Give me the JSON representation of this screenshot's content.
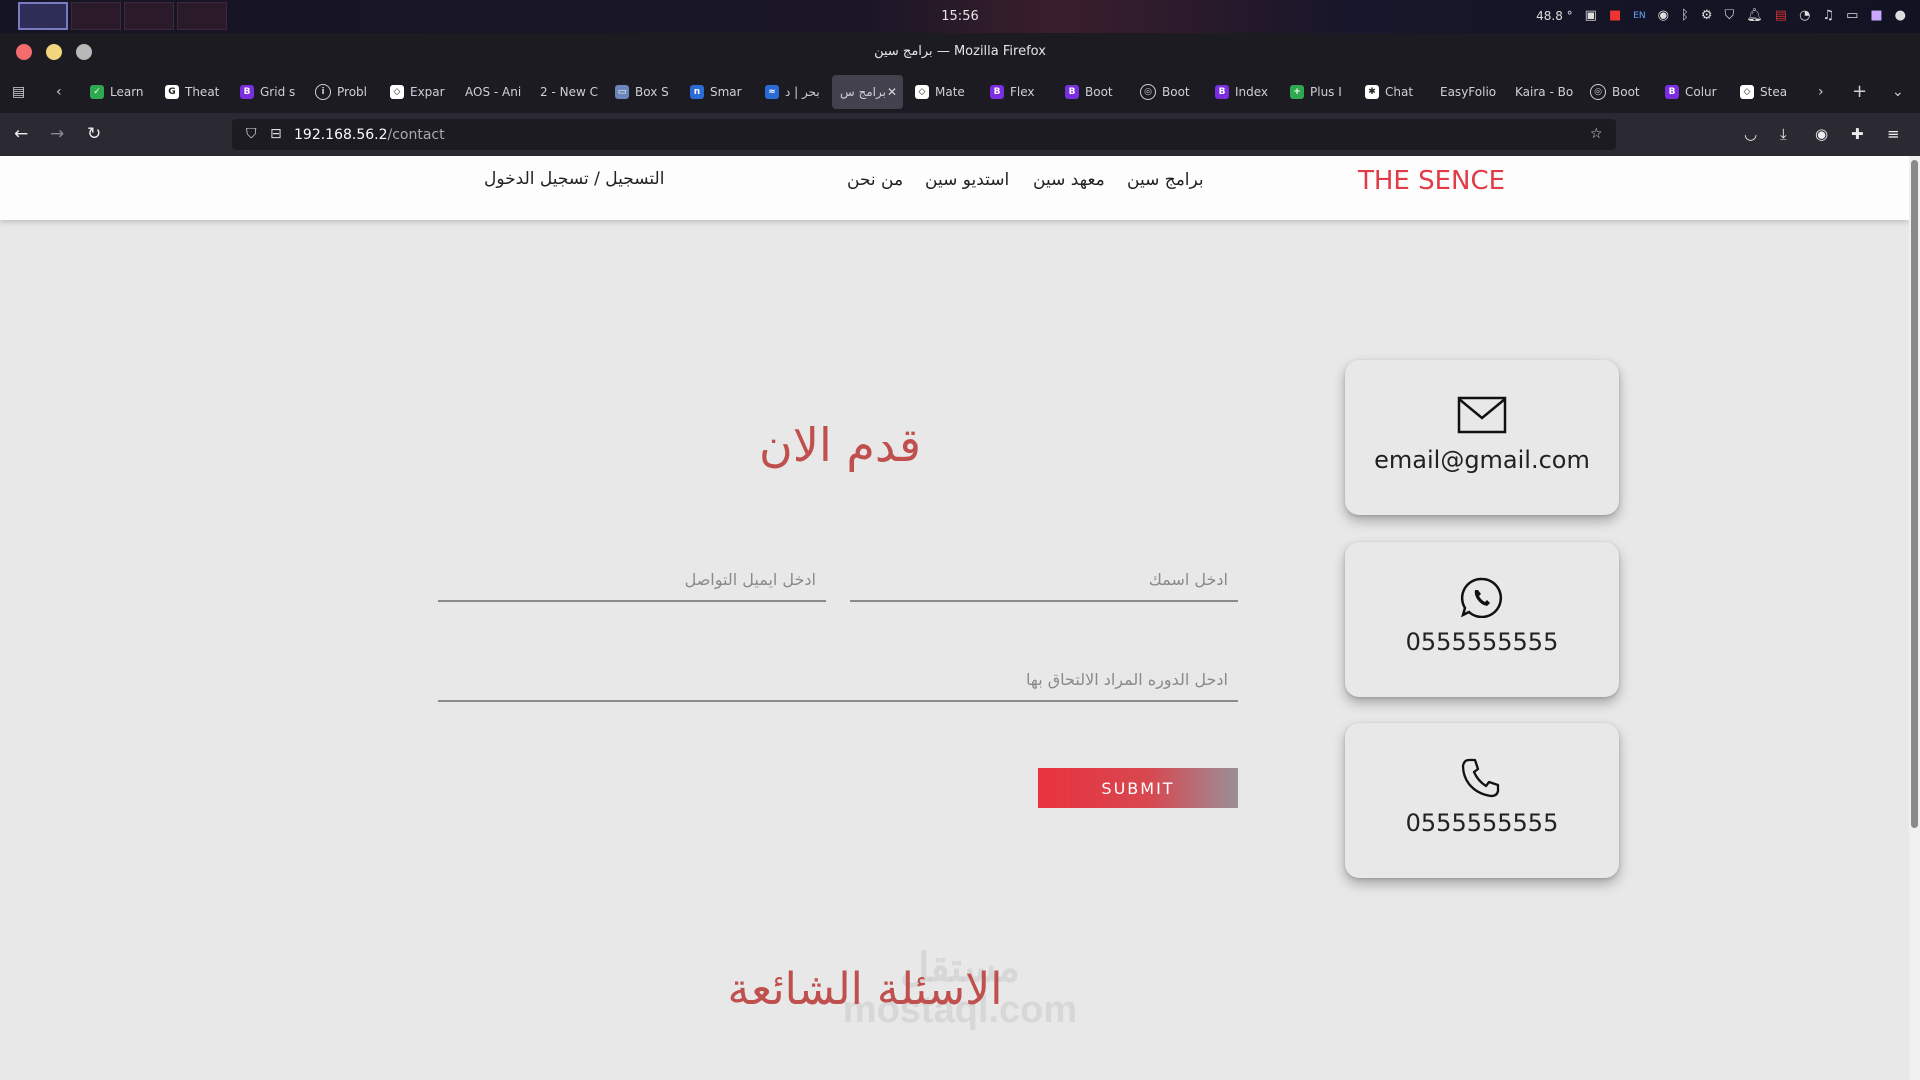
{
  "os": {
    "clock": "15:56",
    "temperature": "48.8 °",
    "keyboard_layout": "EN"
  },
  "window": {
    "title": "برامج سين — Mozilla Firefox"
  },
  "tabs": [
    {
      "label": "Learn",
      "icon": "leaf-icon",
      "color": "#2fa84f"
    },
    {
      "label": "Theat",
      "icon": "google-icon",
      "color": "#ffffff"
    },
    {
      "label": "Grid s",
      "icon": "bootstrap-icon",
      "color": "#7a2ee0"
    },
    {
      "label": "Probl",
      "icon": "info-icon",
      "color": "#00000000"
    },
    {
      "label": "Expar",
      "icon": "codepen-icon",
      "color": "#ffffff"
    },
    {
      "label": "AOS - Ani",
      "icon": "",
      "color": ""
    },
    {
      "label": "2 - New C",
      "icon": "",
      "color": ""
    },
    {
      "label": "Box S",
      "icon": "box-icon",
      "color": "#6b86b8"
    },
    {
      "label": "Smar",
      "icon": "n-icon",
      "color": "#2b6bd6"
    },
    {
      "label": "بحر | د",
      "icon": "bahr-icon",
      "color": "#2b6bd6"
    },
    {
      "label": "برامج س",
      "icon": "",
      "color": "",
      "active": true
    },
    {
      "label": "Mate",
      "icon": "codepen-icon",
      "color": "#ffffff"
    },
    {
      "label": "Flex",
      "icon": "bootstrap-icon",
      "color": "#7a2ee0"
    },
    {
      "label": "Boot",
      "icon": "bootstrap-icon",
      "color": "#7a2ee0"
    },
    {
      "label": "Boot",
      "icon": "globe-icon",
      "color": ""
    },
    {
      "label": "Index",
      "icon": "bootstrap-icon",
      "color": "#7a2ee0"
    },
    {
      "label": "Plus I",
      "icon": "plus-icon",
      "color": "#2fa84f"
    },
    {
      "label": "Chat",
      "icon": "chatgpt-icon",
      "color": "#ffffff"
    },
    {
      "label": "EasyFolio",
      "icon": "",
      "color": ""
    },
    {
      "label": "Kaira - Bo",
      "icon": "",
      "color": ""
    },
    {
      "label": "Boot",
      "icon": "globe-icon",
      "color": ""
    },
    {
      "label": "Colur",
      "icon": "bootstrap-icon",
      "color": "#7a2ee0"
    },
    {
      "label": "Stea",
      "icon": "codepen-icon",
      "color": "#ffffff"
    }
  ],
  "url": {
    "host": "192.168.56.2",
    "path": "/contact"
  },
  "site": {
    "brand": "THE SENCE",
    "brand_color": "#e23a46",
    "nav": [
      {
        "label": "برامج سين"
      },
      {
        "label": "معهد سين"
      },
      {
        "label": "استديو سين"
      },
      {
        "label": "من نحن"
      }
    ],
    "login": "التسجيل / تسجيل الدخول"
  },
  "form": {
    "title": "قدم الان",
    "name_placeholder": "ادخل اسمك",
    "email_placeholder": "ادخل ايميل التواصل",
    "course_placeholder": "ادحل الدوره المراد الالتحاق بها",
    "submit": "SUBMIT",
    "accent_color": "#c0504d"
  },
  "contacts": [
    {
      "icon": "envelope-icon",
      "text": "email@gmail.com"
    },
    {
      "icon": "whatsapp-icon",
      "text": "0555555555"
    },
    {
      "icon": "phone-icon",
      "text": "0555555555"
    }
  ],
  "faq": {
    "title": "الاسئلة الشائعة"
  },
  "watermark": {
    "arabic": "مستقل",
    "latin": "mostaql.com"
  }
}
